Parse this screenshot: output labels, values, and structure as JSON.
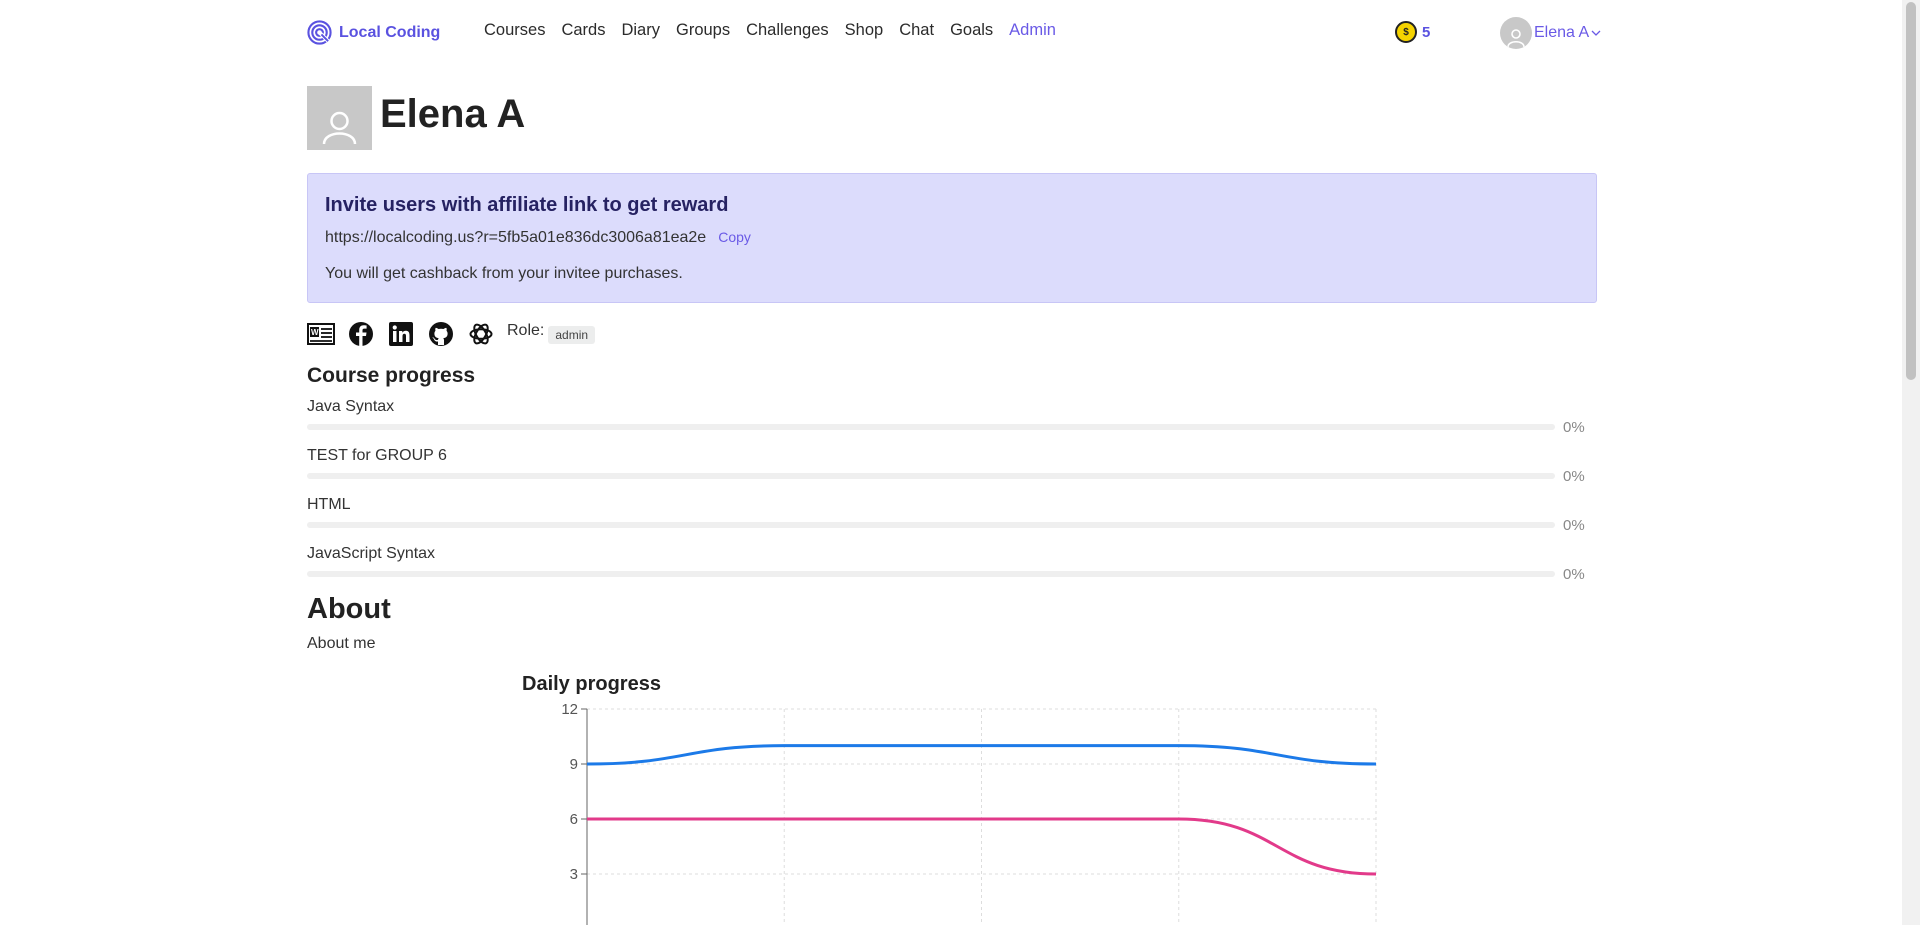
{
  "navbar": {
    "brand": "Local Coding",
    "links": [
      {
        "label": "Courses",
        "active": false
      },
      {
        "label": "Cards",
        "active": false
      },
      {
        "label": "Diary",
        "active": false
      },
      {
        "label": "Groups",
        "active": false
      },
      {
        "label": "Challenges",
        "active": false
      },
      {
        "label": "Shop",
        "active": false
      },
      {
        "label": "Chat",
        "active": false
      },
      {
        "label": "Goals",
        "active": false
      },
      {
        "label": "Admin",
        "active": true
      }
    ],
    "coins": "5",
    "user_name": "Elena A"
  },
  "profile": {
    "name": "Elena A"
  },
  "invite": {
    "title": "Invite users with affiliate link to get reward",
    "link": "https://localcoding.us?r=5fb5a01e836dc3006a81ea2e",
    "copy_label": "Copy",
    "note": "You will get cashback from your invitee purchases."
  },
  "social": {
    "icons": [
      "cv-icon",
      "facebook-icon",
      "linkedin-icon",
      "github-icon",
      "openai-icon"
    ],
    "role_label": "Role:",
    "role_value": "admin"
  },
  "course_progress": {
    "title": "Course progress",
    "courses": [
      {
        "name": "Java Syntax",
        "percent": 0,
        "percent_label": "0%"
      },
      {
        "name": "TEST for GROUP 6",
        "percent": 0,
        "percent_label": "0%"
      },
      {
        "name": "HTML",
        "percent": 0,
        "percent_label": "0%"
      },
      {
        "name": "JavaScript Syntax",
        "percent": 0,
        "percent_label": "0%"
      }
    ]
  },
  "about": {
    "title": "About",
    "text": "About me"
  },
  "colors": {
    "accent": "#6a5ae6",
    "invite_bg": "#dcdcfc",
    "series_blue": "#1c7ae8",
    "series_pink": "#e23a8a"
  },
  "chart_data": {
    "type": "line",
    "title": "Daily progress",
    "xlabel": "",
    "ylabel": "",
    "ylim": [
      0,
      12
    ],
    "y_ticks": [
      "12",
      "9",
      "6",
      "3"
    ],
    "x": [
      0,
      1,
      2,
      3,
      4
    ],
    "series": [
      {
        "values": [
          9,
          10,
          10,
          10,
          9
        ],
        "color": "#1c7ae8"
      },
      {
        "values": [
          6,
          6,
          6,
          6,
          3
        ],
        "color": "#e23a8a"
      }
    ],
    "grid": true
  }
}
